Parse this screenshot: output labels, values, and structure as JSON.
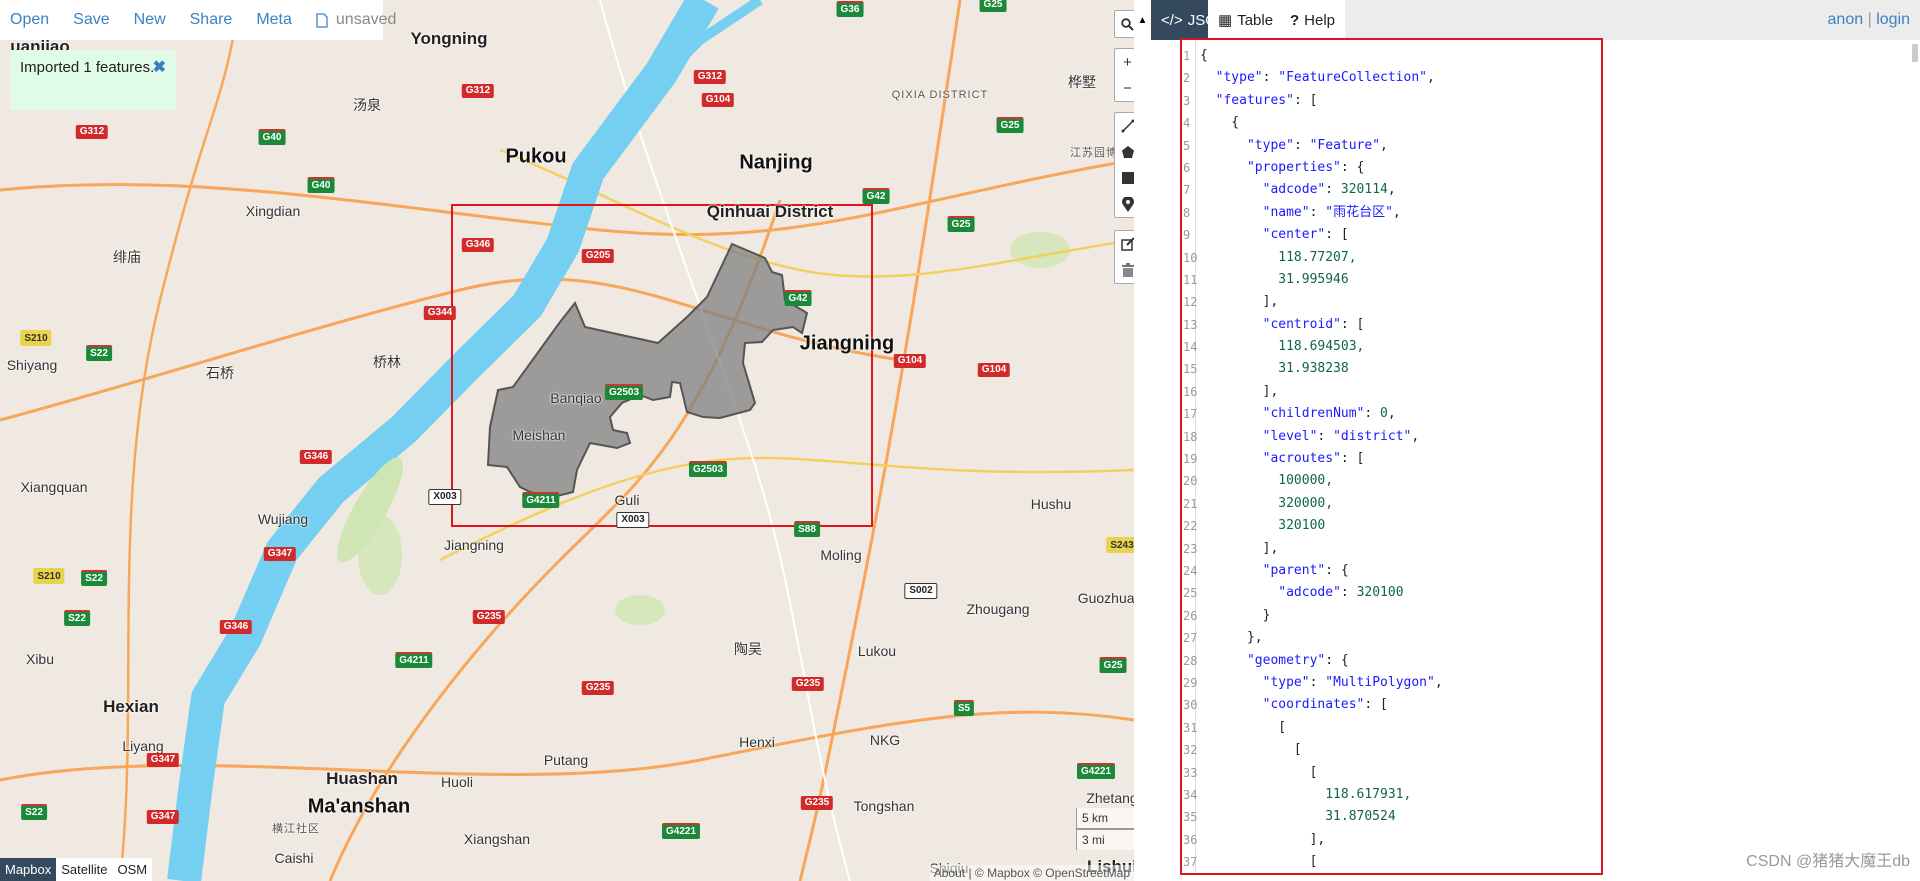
{
  "menu": {
    "items": [
      "Open",
      "Save",
      "New",
      "Share",
      "Meta"
    ],
    "status": "unsaved"
  },
  "notice": {
    "text": "Imported 1 features.",
    "close": "✖"
  },
  "map": {
    "labels": [
      {
        "t": "uanjiao",
        "c": "med"
      },
      {
        "t": "Yongning",
        "c": "med"
      },
      {
        "t": "汤泉",
        "c": ""
      },
      {
        "t": "Pukou",
        "c": "big"
      },
      {
        "t": "Nanjing",
        "c": "big"
      },
      {
        "t": "QIXIA DISTRICT",
        "c": "small"
      },
      {
        "t": "桦墅",
        "c": ""
      },
      {
        "t": "江苏园博园",
        "c": "small"
      },
      {
        "t": "Qinhuai District",
        "c": "med"
      },
      {
        "t": "Xingdian",
        "c": ""
      },
      {
        "t": "绯庙",
        "c": ""
      },
      {
        "t": "Jiangning",
        "c": "big"
      },
      {
        "t": "Shiyang",
        "c": ""
      },
      {
        "t": "石桥",
        "c": ""
      },
      {
        "t": "桥林",
        "c": ""
      },
      {
        "t": "Banqiao",
        "c": ""
      },
      {
        "t": "Meishan",
        "c": ""
      },
      {
        "t": "Xiangquan",
        "c": ""
      },
      {
        "t": "Wujiang",
        "c": ""
      },
      {
        "t": "Jiangning",
        "c": ""
      },
      {
        "t": "Guli",
        "c": ""
      },
      {
        "t": "Moling",
        "c": ""
      },
      {
        "t": "Hushu",
        "c": ""
      },
      {
        "t": "Zhougang",
        "c": ""
      },
      {
        "t": "Guozhuan",
        "c": ""
      },
      {
        "t": "Xibu",
        "c": ""
      },
      {
        "t": "Hexian",
        "c": "med"
      },
      {
        "t": "Liyang",
        "c": ""
      },
      {
        "t": "陶吴",
        "c": ""
      },
      {
        "t": "Lukou",
        "c": ""
      },
      {
        "t": "Henxi",
        "c": ""
      },
      {
        "t": "Putang",
        "c": ""
      },
      {
        "t": "Huoli",
        "c": ""
      },
      {
        "t": "Huashan",
        "c": "med"
      },
      {
        "t": "Ma'anshan",
        "c": "big"
      },
      {
        "t": "横江社区",
        "c": "small"
      },
      {
        "t": "Caishi",
        "c": ""
      },
      {
        "t": "Xiangshan",
        "c": ""
      },
      {
        "t": "Tongshan",
        "c": ""
      },
      {
        "t": "Shiqiu",
        "c": ""
      },
      {
        "t": "Lishui",
        "c": "med"
      },
      {
        "t": "Zhetang",
        "c": ""
      },
      {
        "t": "NKG",
        "c": ""
      }
    ],
    "shields": [
      {
        "t": "G36",
        "c": "g"
      },
      {
        "t": "G25",
        "c": "g"
      },
      {
        "t": "G312",
        "c": "r"
      },
      {
        "t": "G312",
        "c": "r"
      },
      {
        "t": "G104",
        "c": "r"
      },
      {
        "t": "G312",
        "c": "r"
      },
      {
        "t": "G40",
        "c": "g"
      },
      {
        "t": "G40",
        "c": "g"
      },
      {
        "t": "G25",
        "c": "g"
      },
      {
        "t": "G42",
        "c": "g"
      },
      {
        "t": "G25",
        "c": "g"
      },
      {
        "t": "G346",
        "c": "r"
      },
      {
        "t": "G205",
        "c": "r"
      },
      {
        "t": "G344",
        "c": "r"
      },
      {
        "t": "G42",
        "c": "g"
      },
      {
        "t": "S210",
        "c": "y"
      },
      {
        "t": "S22",
        "c": "g"
      },
      {
        "t": "G104",
        "c": "r"
      },
      {
        "t": "G104",
        "c": "r"
      },
      {
        "t": "G2503",
        "c": "g"
      },
      {
        "t": "G346",
        "c": "r"
      },
      {
        "t": "G2503",
        "c": "g"
      },
      {
        "t": "X003",
        "c": "w"
      },
      {
        "t": "G4211",
        "c": "g"
      },
      {
        "t": "X003",
        "c": "w"
      },
      {
        "t": "S88",
        "c": "g"
      },
      {
        "t": "S243",
        "c": "y"
      },
      {
        "t": "G347",
        "c": "r"
      },
      {
        "t": "S210",
        "c": "y"
      },
      {
        "t": "S22",
        "c": "g"
      },
      {
        "t": "G235",
        "c": "r"
      },
      {
        "t": "S002",
        "c": "w"
      },
      {
        "t": "G346",
        "c": "r"
      },
      {
        "t": "S22",
        "c": "g"
      },
      {
        "t": "G4211",
        "c": "g"
      },
      {
        "t": "G25",
        "c": "g"
      },
      {
        "t": "G235",
        "c": "r"
      },
      {
        "t": "G235",
        "c": "r"
      },
      {
        "t": "S5",
        "c": "g"
      },
      {
        "t": "G347",
        "c": "r"
      },
      {
        "t": "G4221",
        "c": "g"
      },
      {
        "t": "G235",
        "c": "r"
      },
      {
        "t": "G347",
        "c": "r"
      },
      {
        "t": "G4221",
        "c": "g"
      },
      {
        "t": "S22",
        "c": "g"
      }
    ],
    "controls": {
      "search": "search-icon",
      "zoom_in": "+",
      "zoom_out": "−",
      "draw": [
        "line",
        "polygon",
        "rectangle",
        "marker"
      ],
      "edit": [
        "edit",
        "delete"
      ]
    },
    "basemaps": [
      "Mapbox",
      "Satellite",
      "OSM"
    ],
    "active_basemap": "Mapbox",
    "scale": {
      "km": "5 km",
      "mi": "3 mi"
    },
    "attribution": "About | © Mapbox © OpenStreetMap",
    "colors": {
      "water": "#75cff0",
      "land": "#efe9e1",
      "feature_fill": "#808080",
      "bbox": "#e0141e"
    }
  },
  "panel": {
    "tabs": [
      {
        "icon": "</>",
        "label": "JSON"
      },
      {
        "icon": "▦",
        "label": "Table"
      },
      {
        "icon": "?",
        "label": "Help"
      }
    ],
    "active_tab": "JSON",
    "user": {
      "anon": "anon",
      "sep": "|",
      "login": "login"
    },
    "code_lines": [
      "{",
      "  \"type\": \"FeatureCollection\",",
      "  \"features\": [",
      "    {",
      "      \"type\": \"Feature\",",
      "      \"properties\": {",
      "        \"adcode\": 320114,",
      "        \"name\": \"雨花台区\",",
      "        \"center\": [",
      "          118.77207,",
      "          31.995946",
      "        ],",
      "        \"centroid\": [",
      "          118.694503,",
      "          31.938238",
      "        ],",
      "        \"childrenNum\": 0,",
      "        \"level\": \"district\",",
      "        \"acroutes\": [",
      "          100000,",
      "          320000,",
      "          320100",
      "        ],",
      "        \"parent\": {",
      "          \"adcode\": 320100",
      "        }",
      "      },",
      "      \"geometry\": {",
      "        \"type\": \"MultiPolygon\",",
      "        \"coordinates\": [",
      "          [",
      "            [",
      "              [",
      "                118.617931,",
      "                31.870524",
      "              ],",
      "              ["
    ]
  },
  "watermark": "CSDN @猪猪大魔王db"
}
